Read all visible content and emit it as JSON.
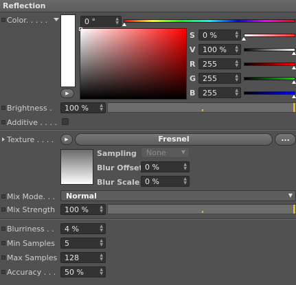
{
  "section": {
    "title": "Reflection"
  },
  "color": {
    "label": "Color. . . . .",
    "hue": "0 °",
    "channels": [
      {
        "key": "S",
        "value": "0 %"
      },
      {
        "key": "V",
        "value": "100 %"
      },
      {
        "key": "R",
        "value": "255"
      },
      {
        "key": "G",
        "value": "255"
      },
      {
        "key": "B",
        "value": "255"
      }
    ],
    "swatch_color": "#ffffff",
    "picker_hue_color": "#ff0000"
  },
  "brightness": {
    "label": "Brightness .",
    "value": "100 %",
    "level": 1.0
  },
  "additive": {
    "label": "Additive . . . .",
    "checked": false
  },
  "texture": {
    "label": "Texture . . . .",
    "shader_name": "Fresnel",
    "more_button": "...",
    "sampling_label": "Sampling",
    "sampling_value": "None",
    "blur_offset_label": "Blur Offset",
    "blur_offset_value": "0 %",
    "blur_scale_label": "Blur Scale",
    "blur_scale_value": "0 %"
  },
  "mix_mode": {
    "label": "Mix Mode. . .",
    "value": "Normal"
  },
  "mix_strength": {
    "label": "Mix Strength",
    "value": "100 %",
    "level": 1.0
  },
  "blurriness": {
    "label": "Blurriness . .",
    "value": "4 %"
  },
  "min_samples": {
    "label": "Min Samples",
    "value": "5"
  },
  "max_samples": {
    "label": "Max Samples",
    "value": "128"
  },
  "accuracy": {
    "label": "Accuracy . . .",
    "value": "50 %"
  },
  "colors": {
    "accent": "#f0b020",
    "panel": "#515151",
    "field": "#333333"
  }
}
